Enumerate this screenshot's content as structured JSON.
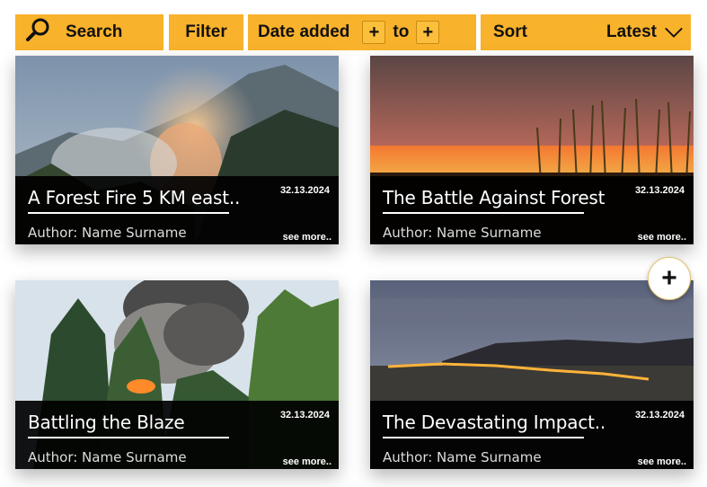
{
  "toolbar": {
    "search_label": "Search",
    "filter_label": "Filter",
    "date_label": "Date added",
    "date_add": "+",
    "to_label": "to",
    "date_add_2": "+",
    "sort_label": "Sort",
    "sort_value": "Latest"
  },
  "cards": [
    {
      "title": "A Forest Fire 5 KM east..",
      "date": "32.13.2024",
      "author": "Author: Name Surname",
      "more": "see more.."
    },
    {
      "title": "The Battle Against Forest",
      "date": "32.13.2024",
      "author": "Author: Name Surname",
      "more": "see more.."
    },
    {
      "title": "Battling the Blaze",
      "date": "32.13.2024",
      "author": "Author: Name Surname",
      "more": "see more.."
    },
    {
      "title": "The Devastating Impact..",
      "date": "32.13.2024",
      "author": "Author: Name Surname",
      "more": "see more.."
    }
  ],
  "add_button": "+",
  "colors": {
    "accent": "#f9b22b",
    "overlay": "#000000"
  }
}
